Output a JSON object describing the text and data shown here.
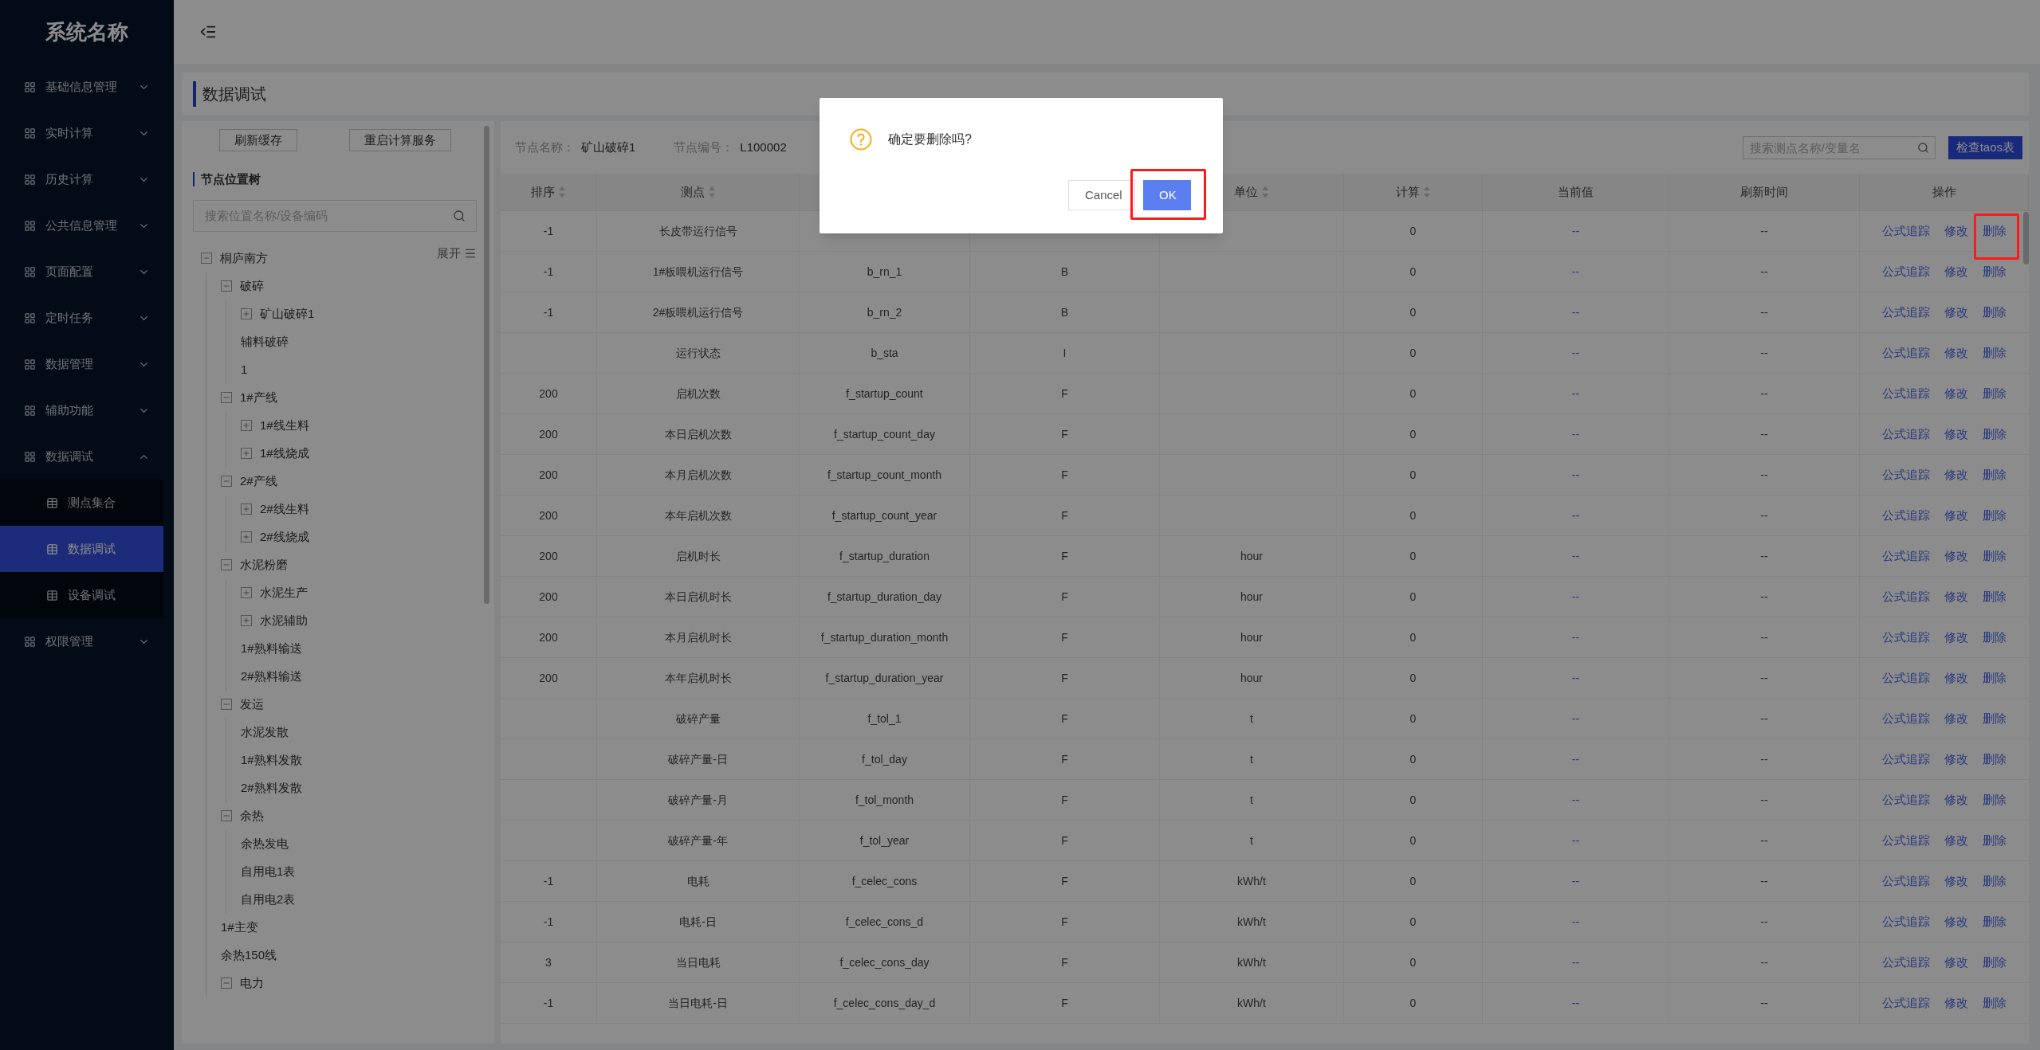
{
  "app": {
    "title": "系统名称"
  },
  "sidebar": {
    "items": [
      {
        "label": "基础信息管理",
        "expanded": false
      },
      {
        "label": "实时计算",
        "expanded": false
      },
      {
        "label": "历史计算",
        "expanded": false
      },
      {
        "label": "公共信息管理",
        "expanded": false
      },
      {
        "label": "页面配置",
        "expanded": false
      },
      {
        "label": "定时任务",
        "expanded": false
      },
      {
        "label": "数据管理",
        "expanded": false
      },
      {
        "label": "辅助功能",
        "expanded": false
      },
      {
        "label": "数据调试",
        "expanded": true,
        "children": [
          {
            "label": "测点集合",
            "selected": false
          },
          {
            "label": "数据调试",
            "selected": true
          },
          {
            "label": "设备调试",
            "selected": false
          }
        ]
      },
      {
        "label": "权限管理",
        "expanded": false
      }
    ]
  },
  "page": {
    "title": "数据调试"
  },
  "tree_panel": {
    "buttons": [
      "刷新缓存",
      "重启计算服务"
    ],
    "title": "节点位置树",
    "search": {
      "placeholder": "搜索位置名称/设备编码"
    },
    "expand_toggle": "展开",
    "nodes": [
      {
        "label": "桐庐南方",
        "kind": "folder",
        "expanded": true,
        "children": [
          {
            "label": "破碎",
            "kind": "folder",
            "expanded": true,
            "children": [
              {
                "label": "矿山破碎1",
                "kind": "folder",
                "expanded": false
              },
              {
                "label": "辅料破碎",
                "kind": "leaf"
              },
              {
                "label": "1",
                "kind": "leaf"
              }
            ]
          },
          {
            "label": "1#产线",
            "kind": "folder",
            "expanded": true,
            "children": [
              {
                "label": "1#线生料",
                "kind": "folder",
                "expanded": false
              },
              {
                "label": "1#线烧成",
                "kind": "folder",
                "expanded": false
              }
            ]
          },
          {
            "label": "2#产线",
            "kind": "folder",
            "expanded": true,
            "children": [
              {
                "label": "2#线生料",
                "kind": "folder",
                "expanded": false
              },
              {
                "label": "2#线烧成",
                "kind": "folder",
                "expanded": false
              }
            ]
          },
          {
            "label": "水泥粉磨",
            "kind": "folder",
            "expanded": true,
            "children": [
              {
                "label": "水泥生产",
                "kind": "folder",
                "expanded": false
              },
              {
                "label": "水泥辅助",
                "kind": "folder",
                "expanded": false
              },
              {
                "label": "1#熟料输送",
                "kind": "leaf"
              },
              {
                "label": "2#熟料输送",
                "kind": "leaf"
              }
            ]
          },
          {
            "label": "发运",
            "kind": "folder",
            "expanded": true,
            "children": [
              {
                "label": "水泥发散",
                "kind": "leaf"
              },
              {
                "label": "1#熟料发散",
                "kind": "leaf"
              },
              {
                "label": "2#熟料发散",
                "kind": "leaf"
              }
            ]
          },
          {
            "label": "余热",
            "kind": "folder",
            "expanded": true,
            "children": [
              {
                "label": "余热发电",
                "kind": "leaf"
              },
              {
                "label": "自用电1表",
                "kind": "leaf"
              },
              {
                "label": "自用电2表",
                "kind": "leaf"
              }
            ]
          },
          {
            "label": "1#主变",
            "kind": "leaf"
          },
          {
            "label": "余热150线",
            "kind": "leaf"
          },
          {
            "label": "电力",
            "kind": "folder",
            "expanded": true
          }
        ]
      }
    ]
  },
  "table_panel": {
    "info": [
      {
        "label": "节点名称：",
        "value": "矿山破碎1"
      },
      {
        "label": "节点编号：",
        "value": "L100002"
      }
    ],
    "search": {
      "placeholder": "搜索测点名称/变量名"
    },
    "check_button": "检查taos表",
    "columns": [
      {
        "label": "排序",
        "sortable": true
      },
      {
        "label": "测点",
        "sortable": true
      },
      {},
      {},
      {
        "label": "单位",
        "sortable": true
      },
      {
        "label": "计算",
        "sortable": true
      },
      {
        "label": "当前值",
        "sortable": false
      },
      {
        "label": "刷新时间",
        "sortable": false
      },
      {
        "label": "操作",
        "sortable": false
      }
    ],
    "rows": [
      {
        "sort": "-1",
        "point": "长皮带运行信号",
        "calc": "0",
        "current": "--",
        "refresh": "--",
        "actions": [
          "公式追踪",
          "修改",
          "删除"
        ],
        "highlighted": true
      },
      {
        "sort": "-1",
        "point": "1#板喂机运行信号",
        "variable": "b_rn_1",
        "type": "B",
        "calc": "0",
        "current": "--",
        "refresh": "--",
        "actions": [
          "公式追踪",
          "修改",
          "删除"
        ],
        "highlighted": false
      },
      {
        "sort": "-1",
        "point": "2#板喂机运行信号",
        "variable": "b_rn_2",
        "type": "B",
        "calc": "0",
        "current": "--",
        "refresh": "--",
        "actions": [
          "公式追踪",
          "修改",
          "删除"
        ],
        "highlighted": false
      },
      {
        "point": "运行状态",
        "variable": "b_sta",
        "type": "I",
        "calc": "0",
        "current": "--",
        "refresh": "--",
        "actions": [
          "公式追踪",
          "修改",
          "删除"
        ],
        "highlighted": false
      },
      {
        "sort": "200",
        "point": "启机次数",
        "variable": "f_startup_count",
        "type": "F",
        "calc": "0",
        "current": "--",
        "refresh": "--",
        "actions": [
          "公式追踪",
          "修改",
          "删除"
        ],
        "highlighted": false
      },
      {
        "sort": "200",
        "point": "本日启机次数",
        "variable": "f_startup_count_day",
        "type": "F",
        "calc": "0",
        "current": "--",
        "refresh": "--",
        "actions": [
          "公式追踪",
          "修改",
          "删除"
        ],
        "highlighted": false
      },
      {
        "sort": "200",
        "point": "本月启机次数",
        "variable": "f_startup_count_month",
        "type": "F",
        "calc": "0",
        "current": "--",
        "refresh": "--",
        "actions": [
          "公式追踪",
          "修改",
          "删除"
        ],
        "highlighted": false
      },
      {
        "sort": "200",
        "point": "本年启机次数",
        "variable": "f_startup_count_year",
        "type": "F",
        "calc": "0",
        "current": "--",
        "refresh": "--",
        "actions": [
          "公式追踪",
          "修改",
          "删除"
        ],
        "highlighted": false
      },
      {
        "sort": "200",
        "point": "启机时长",
        "variable": "f_startup_duration",
        "type": "F",
        "unit": "hour",
        "calc": "0",
        "current": "--",
        "refresh": "--",
        "actions": [
          "公式追踪",
          "修改",
          "删除"
        ],
        "highlighted": false
      },
      {
        "sort": "200",
        "point": "本日启机时长",
        "variable": "f_startup_duration_day",
        "type": "F",
        "unit": "hour",
        "calc": "0",
        "current": "--",
        "refresh": "--",
        "actions": [
          "公式追踪",
          "修改",
          "删除"
        ],
        "highlighted": false
      },
      {
        "sort": "200",
        "point": "本月启机时长",
        "variable": "f_startup_duration_month",
        "type": "F",
        "unit": "hour",
        "calc": "0",
        "current": "--",
        "refresh": "--",
        "actions": [
          "公式追踪",
          "修改",
          "删除"
        ],
        "highlighted": false
      },
      {
        "sort": "200",
        "point": "本年启机时长",
        "variable": "f_startup_duration_year",
        "type": "F",
        "unit": "hour",
        "calc": "0",
        "current": "--",
        "refresh": "--",
        "actions": [
          "公式追踪",
          "修改",
          "删除"
        ],
        "highlighted": false
      },
      {
        "point": "破碎产量",
        "variable": "f_tol_1",
        "type": "F",
        "unit": "t",
        "calc": "0",
        "current": "--",
        "refresh": "--",
        "actions": [
          "公式追踪",
          "修改",
          "删除"
        ],
        "highlighted": false
      },
      {
        "point": "破碎产量-日",
        "variable": "f_tol_day",
        "type": "F",
        "unit": "t",
        "calc": "0",
        "current": "--",
        "refresh": "--",
        "actions": [
          "公式追踪",
          "修改",
          "删除"
        ],
        "highlighted": false
      },
      {
        "point": "破碎产量-月",
        "variable": "f_tol_month",
        "type": "F",
        "unit": "t",
        "calc": "0",
        "current": "--",
        "refresh": "--",
        "actions": [
          "公式追踪",
          "修改",
          "删除"
        ],
        "highlighted": false
      },
      {
        "point": "破碎产量-年",
        "variable": "f_tol_year",
        "type": "F",
        "unit": "t",
        "calc": "0",
        "current": "--",
        "refresh": "--",
        "actions": [
          "公式追踪",
          "修改",
          "删除"
        ],
        "highlighted": false
      },
      {
        "sort": "-1",
        "point": "电耗",
        "variable": "f_celec_cons",
        "type": "F",
        "unit": "kWh/t",
        "calc": "0",
        "current": "--",
        "refresh": "--",
        "actions": [
          "公式追踪",
          "修改",
          "删除"
        ],
        "highlighted": false
      },
      {
        "sort": "-1",
        "point": "电耗-日",
        "variable": "f_celec_cons_d",
        "type": "F",
        "unit": "kWh/t",
        "calc": "0",
        "current": "--",
        "refresh": "--",
        "actions": [
          "公式追踪",
          "修改",
          "删除"
        ],
        "highlighted": false
      },
      {
        "sort": "3",
        "point": "当日电耗",
        "variable": "f_celec_cons_day",
        "type": "F",
        "unit": "kWh/t",
        "calc": "0",
        "current": "--",
        "refresh": "--",
        "actions": [
          "公式追踪",
          "修改",
          "删除"
        ],
        "highlighted": false
      },
      {
        "sort": "-1",
        "point": "当日电耗-日",
        "variable": "f_celec_cons_day_d",
        "type": "F",
        "unit": "kWh/t",
        "calc": "0",
        "current": "--",
        "refresh": "--",
        "actions": [
          "公式追踪",
          "修改",
          "删除"
        ],
        "highlighted": false
      }
    ]
  },
  "dialog": {
    "message": "确定要删除吗?",
    "buttons": [
      {
        "label": "Cancel",
        "kind": "default",
        "highlighted": false
      },
      {
        "label": "OK",
        "kind": "primary",
        "highlighted": true
      }
    ]
  }
}
